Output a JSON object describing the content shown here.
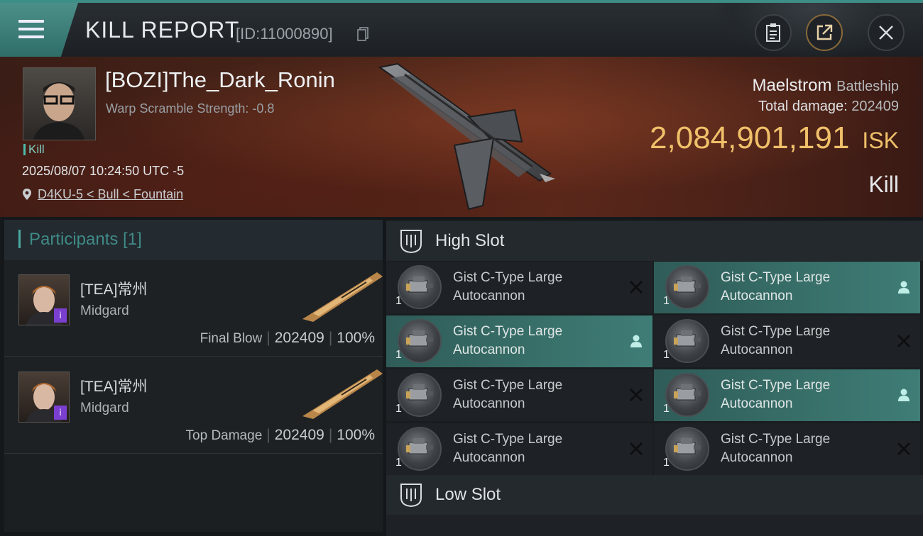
{
  "header": {
    "title": "KILL REPORT",
    "report_id": "[ID:11000890]"
  },
  "victim": {
    "name": "[BOZI]The_Dark_Ronin",
    "scramble": "Warp Scramble Strength: -0.8",
    "tag": "Kill",
    "datetime": "2025/08/07 10:24:50 UTC -5",
    "location": "D4KU-5 < Bull < Fountain",
    "ship_name": "Maelstrom",
    "ship_class": "Battleship",
    "damage_label": "Total damage:",
    "damage_value": "202409",
    "isk_value": "2,084,901,191",
    "isk_unit": "ISK",
    "kill_type": "Kill"
  },
  "participants": {
    "title": "Participants [1]",
    "rows": [
      {
        "name": "[TEA]常州",
        "ship": "Midgard",
        "role": "Final Blow",
        "damage": "202409",
        "percent": "100%"
      },
      {
        "name": "[TEA]常州",
        "ship": "Midgard",
        "role": "Top Damage",
        "damage": "202409",
        "percent": "100%"
      }
    ]
  },
  "slots": {
    "high": {
      "title": "High Slot",
      "items": [
        {
          "name": "Gist C-Type Large Autocannon",
          "qty": "1",
          "state": "destroyed"
        },
        {
          "name": "Gist C-Type Large Autocannon",
          "qty": "1",
          "state": "dropped"
        },
        {
          "name": "Gist C-Type Large Autocannon",
          "qty": "1",
          "state": "dropped"
        },
        {
          "name": "Gist C-Type Large Autocannon",
          "qty": "1",
          "state": "destroyed"
        },
        {
          "name": "Gist C-Type Large Autocannon",
          "qty": "1",
          "state": "destroyed"
        },
        {
          "name": "Gist C-Type Large Autocannon",
          "qty": "1",
          "state": "dropped"
        },
        {
          "name": "Gist C-Type Large Autocannon",
          "qty": "1",
          "state": "destroyed"
        },
        {
          "name": "Gist C-Type Large Autocannon",
          "qty": "1",
          "state": "destroyed"
        }
      ]
    },
    "low": {
      "title": "Low Slot"
    }
  },
  "colors": {
    "accent": "#3f7d76",
    "isk": "#f0c06a",
    "badge": "#7b3fd0"
  }
}
